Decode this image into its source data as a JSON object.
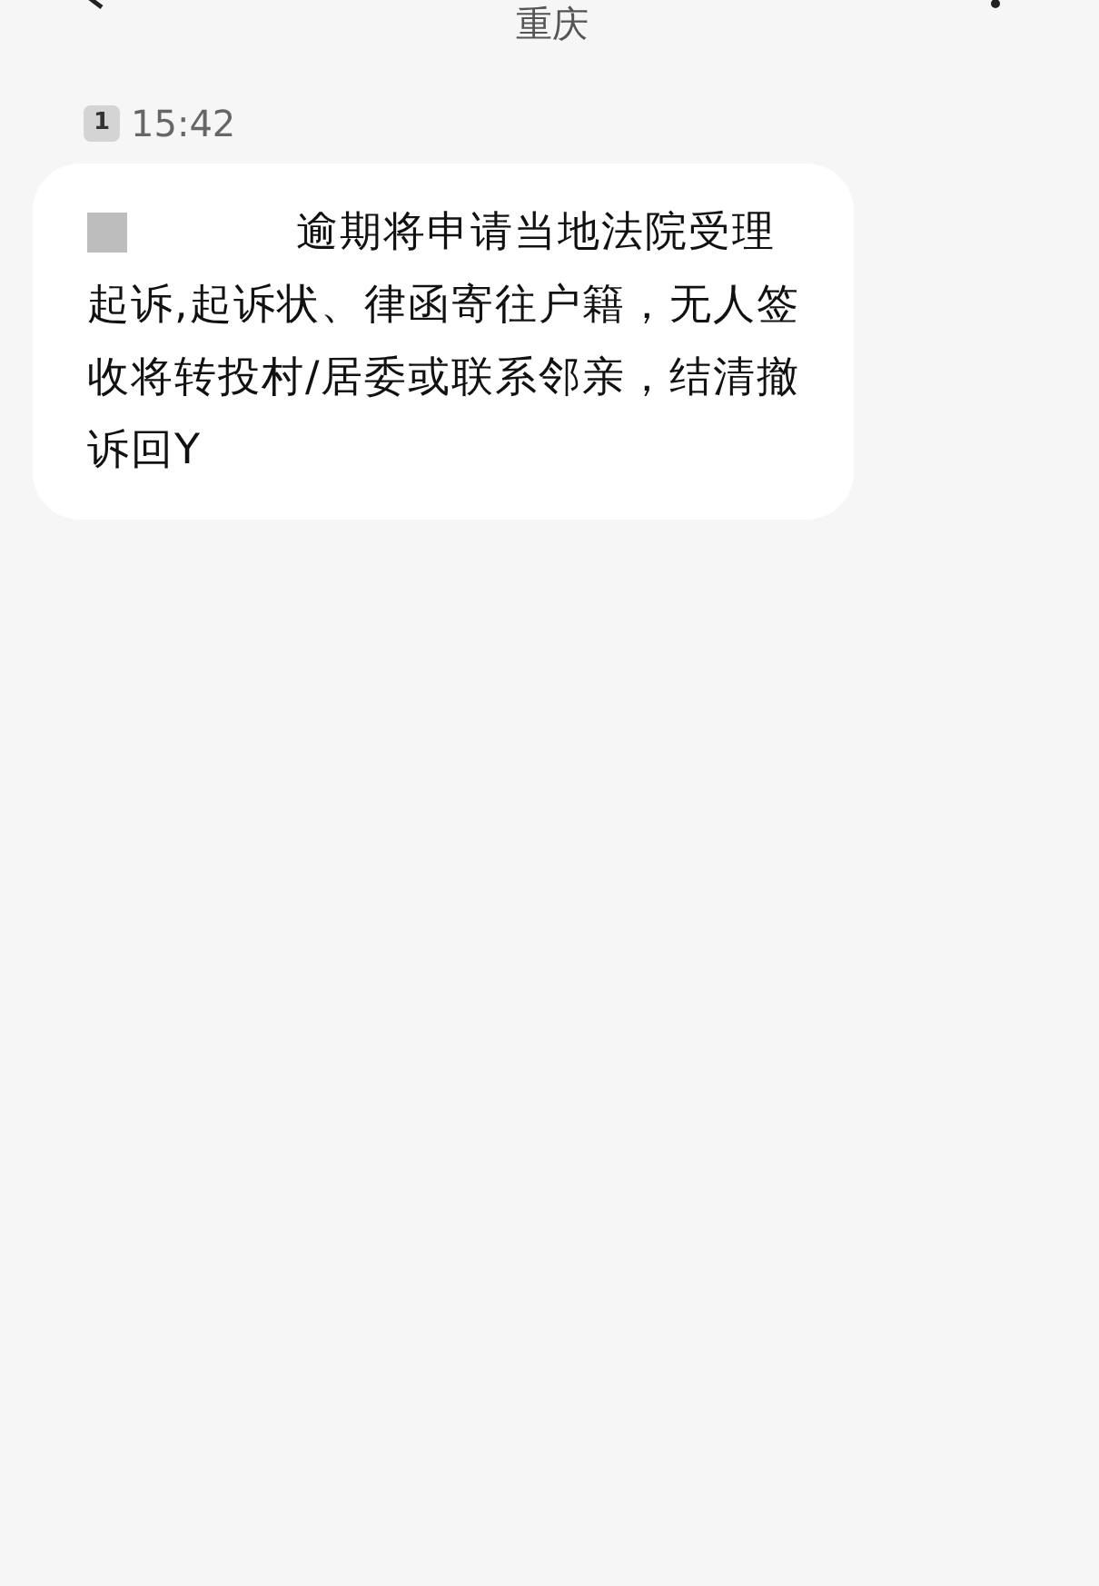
{
  "header": {
    "title": "重庆"
  },
  "messages": [
    {
      "sim": "1",
      "time": "15:42",
      "text": "逾期将申请当地法院受理起诉,起诉状、律函寄往户籍，无人签收将转投村/居委或联系邻亲，结清撤诉回Y"
    }
  ]
}
